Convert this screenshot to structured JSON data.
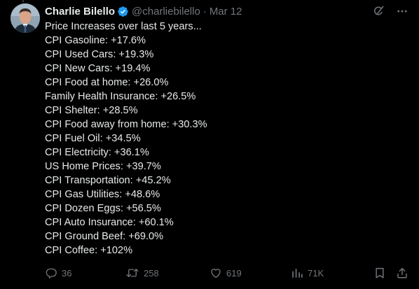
{
  "tweet": {
    "author_name": "Charlie Bilello",
    "handle": "@charliebilello",
    "separator": "·",
    "date": "Mar 12",
    "lines": [
      "Price Increases over last 5 years...",
      "CPI Gasoline: +17.6%",
      "CPI Used Cars: +19.3%",
      "CPI New Cars: +19.4%",
      "CPI Food at home: +26.0%",
      "Family Health Insurance: +26.5%",
      "CPI Shelter: +28.5%",
      "CPI Food away from home: +30.3%",
      "CPI Fuel Oil: +34.5%",
      "CPI Electricity: +36.1%",
      "US Home Prices: +39.7%",
      "CPI Transportation: +45.2%",
      "CPI Gas Utilities: +48.6%",
      "CPI Dozen Eggs: +56.5%",
      "CPI Auto Insurance: +60.1%",
      "CPI Ground Beef: +69.0%",
      "CPI Coffee: +102%"
    ]
  },
  "actions": {
    "replies": "36",
    "reposts": "258",
    "likes": "619",
    "views": "71K"
  },
  "icons": {
    "verified": "verified-badge-icon",
    "grok": "grok-icon",
    "more": "more-icon",
    "reply": "reply-icon",
    "repost": "repost-icon",
    "like": "heart-icon",
    "views": "views-icon",
    "bookmark": "bookmark-icon",
    "share": "share-icon"
  },
  "colors": {
    "background": "#000000",
    "text": "#e7e9ea",
    "muted": "#71767b",
    "verified": "#1d9bf0"
  }
}
